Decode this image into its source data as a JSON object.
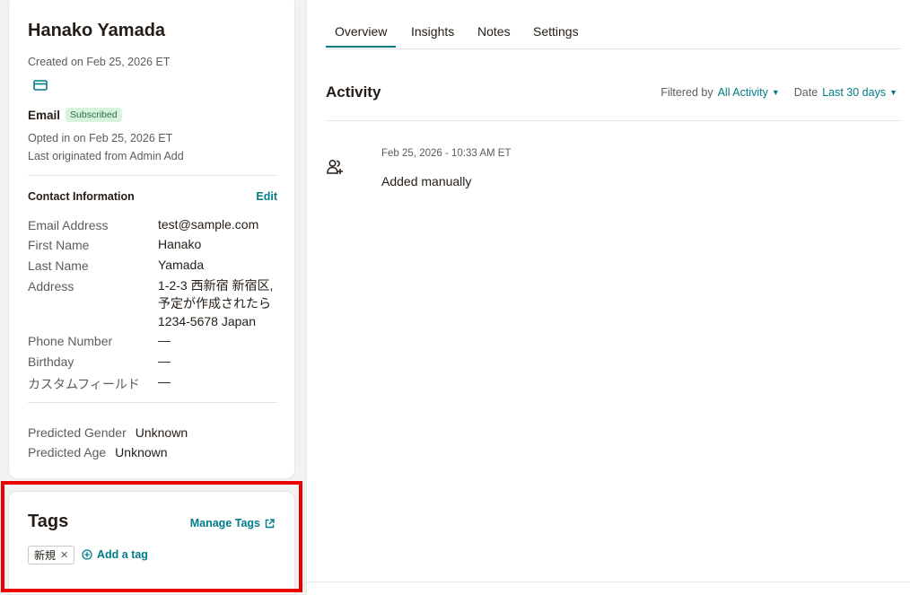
{
  "profile": {
    "name": "Hanako Yamada",
    "created_on": "Created on Feb 25, 2026 ET",
    "email_label": "Email",
    "email_status": "Subscribed",
    "opted_in": "Opted in on Feb 25, 2026 ET",
    "originated": "Last originated from Admin Add",
    "mail_icon": "envelope-icon"
  },
  "contact_info": {
    "heading": "Contact Information",
    "edit_label": "Edit",
    "fields": [
      {
        "label": "Email Address",
        "value": "test@sample.com"
      },
      {
        "label": "First Name",
        "value": "Hanako"
      },
      {
        "label": "Last Name",
        "value": "Yamada"
      },
      {
        "label": "Address",
        "value_lines": [
          "1-2-3 西新宿 新宿区,",
          "予定が作成されたら",
          "1234-5678 Japan"
        ]
      },
      {
        "label": "Phone Number",
        "value": "—"
      },
      {
        "label": "Birthday",
        "value": "—"
      },
      {
        "label": "カスタムフィールド",
        "value": "—"
      }
    ]
  },
  "predictions": {
    "gender_label": "Predicted Gender",
    "gender_value": "Unknown",
    "age_label": "Predicted Age",
    "age_value": "Unknown"
  },
  "tags": {
    "title": "Tags",
    "manage_label": "Manage Tags",
    "items": [
      "新規"
    ],
    "add_label": "Add a tag",
    "highlight_color": "#ea0000"
  },
  "tabs": [
    {
      "label": "Overview",
      "active": true
    },
    {
      "label": "Insights",
      "active": false
    },
    {
      "label": "Notes",
      "active": false
    },
    {
      "label": "Settings",
      "active": false
    }
  ],
  "activity": {
    "title": "Activity",
    "filter_label": "Filtered by",
    "filter_value": "All Activity",
    "date_label": "Date",
    "date_value": "Last 30 days",
    "entries": [
      {
        "time": "Feb 25, 2026 - 10:33 AM ET",
        "description": "Added manually",
        "icon": "user-add-icon"
      }
    ]
  },
  "colors": {
    "accent": "#007c89",
    "badge_bg": "#d7f3dc",
    "badge_text": "#2b6b3f"
  }
}
